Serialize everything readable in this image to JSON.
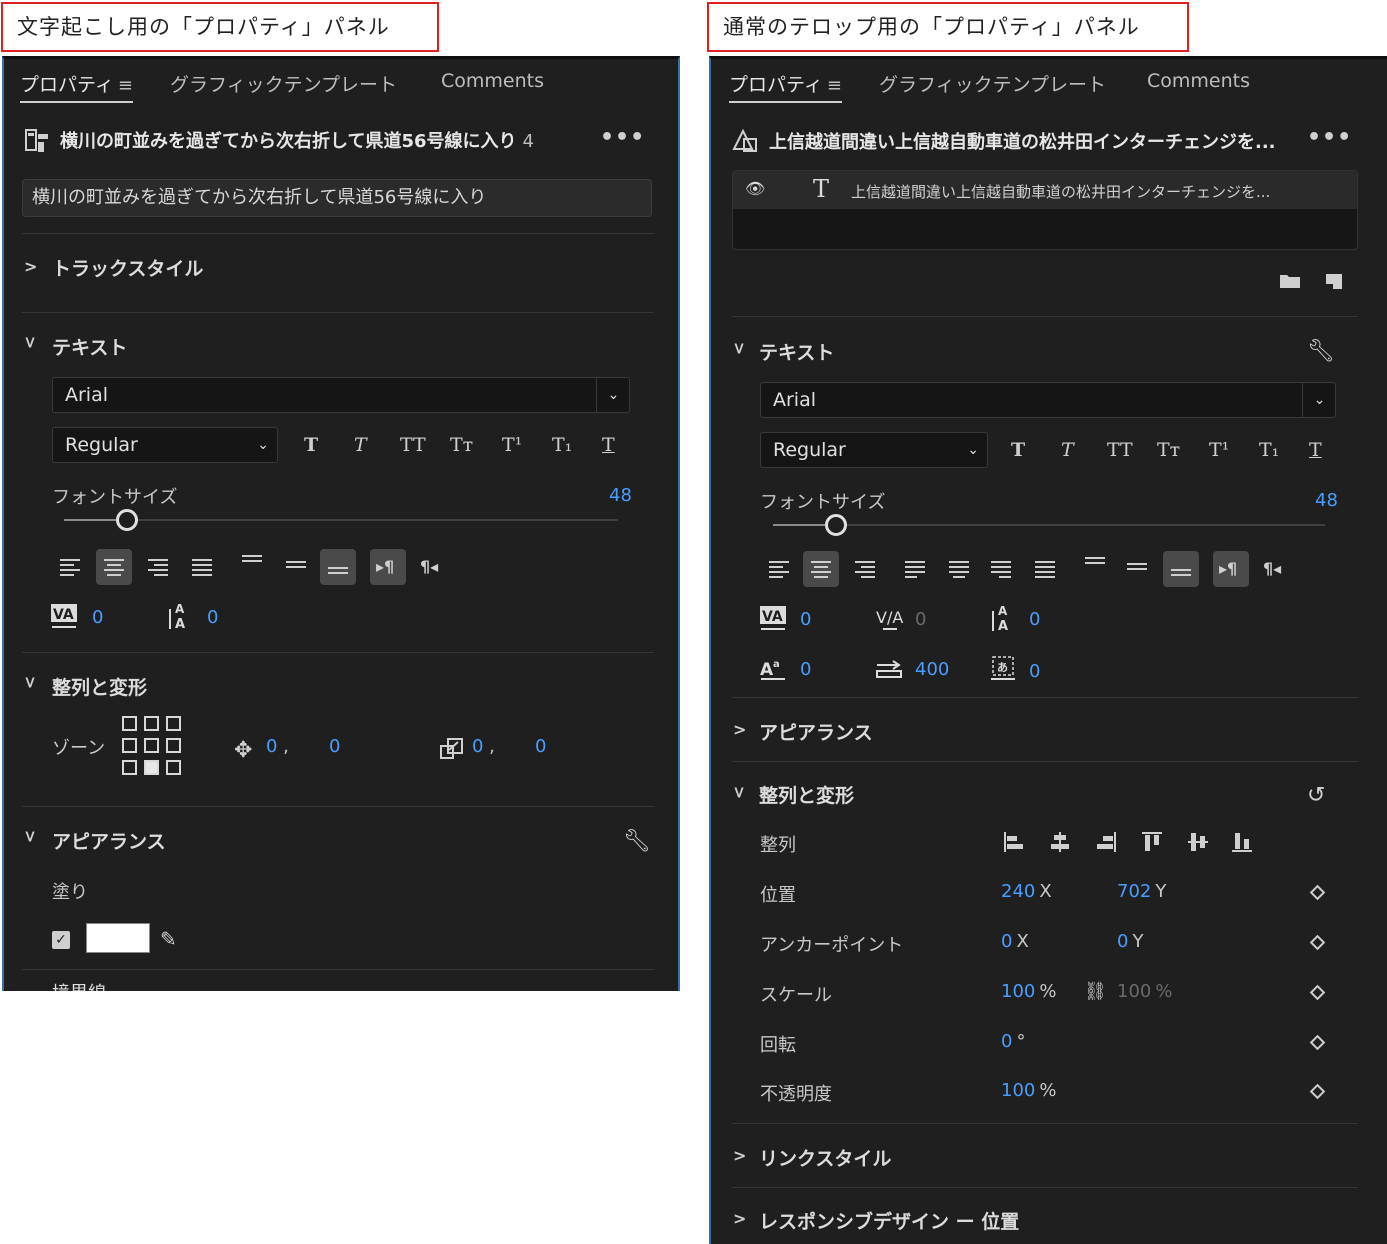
{
  "captions": {
    "left": "文字起こし用の「プロパティ」パネル",
    "right": "通常のテロップ用の「プロパティ」パネル"
  },
  "left_panel": {
    "tabs": [
      {
        "label": "プロパティ",
        "menu": "≡"
      },
      {
        "label": "グラフィックテンプレート"
      },
      {
        "label": "Comments"
      }
    ],
    "title": "横川の町並みを過ぎてから次右折して県道56号線に入り",
    "title_count": "4",
    "more": "•••",
    "text_value": "横川の町並みを過ぎてから次右折して県道56号線に入り",
    "sections": {
      "track_style": "トラックスタイル",
      "text": "テキスト",
      "align_transform": "整列と変形",
      "appearance": "アピアランス",
      "stroke_partial": "境界線"
    },
    "font": {
      "family": "Arial",
      "style": "Regular"
    },
    "format_buttons": [
      "T",
      "T",
      "TT",
      "Tт",
      "T¹",
      "T₁",
      "T"
    ],
    "font_size": {
      "label": "フォントサイズ",
      "value": "48",
      "level": 0.1
    },
    "kerning": {
      "value": "0"
    },
    "leading": {
      "value": "0"
    },
    "zone": {
      "label": "ゾーン"
    },
    "position": {
      "x": "0",
      "y": "0"
    },
    "scale": {
      "x": "0",
      "y": "0"
    },
    "fill": {
      "label": "塗り",
      "color": "#ffffff",
      "checked": true
    }
  },
  "right_panel": {
    "tabs": [
      {
        "label": "プロパティ",
        "menu": "≡"
      },
      {
        "label": "グラフィックテンプレート"
      },
      {
        "label": "Comments"
      }
    ],
    "title": "上信越道間違い上信越自動車道の松井田インターチェンジを...",
    "more": "•••",
    "layer": {
      "name": "上信越道間違い上信越自動車道の松井田インターチェンジを..."
    },
    "sections": {
      "text": "テキスト",
      "appearance": "アピアランス",
      "align_transform": "整列と変形",
      "link_style": "リンクスタイル",
      "responsive": "レスポンシブデザイン ー 位置"
    },
    "font": {
      "family": "Arial",
      "style": "Regular"
    },
    "format_buttons": [
      "T",
      "T",
      "TT",
      "Tт",
      "T¹",
      "T₁",
      "T"
    ],
    "font_size": {
      "label": "フォントサイズ",
      "value": "48",
      "level": 0.1
    },
    "text_metrics": {
      "kerning": "0",
      "tracking": "0",
      "leading": "0",
      "baseline": "0",
      "tab_width": "400",
      "tsume": "0"
    },
    "transform": {
      "align_label": "整列",
      "position": {
        "label": "位置",
        "x": "240",
        "x_unit": "X",
        "y": "702",
        "y_unit": "Y"
      },
      "anchor": {
        "label": "アンカーポイント",
        "x": "0",
        "x_unit": "X",
        "y": "0",
        "y_unit": "Y"
      },
      "scale": {
        "label": "スケール",
        "x": "100",
        "x_unit": "%",
        "y": "100",
        "y_unit": "%"
      },
      "rotation": {
        "label": "回転",
        "value": "0",
        "unit": "°"
      },
      "opacity": {
        "label": "不透明度",
        "value": "100",
        "unit": "%"
      }
    }
  }
}
